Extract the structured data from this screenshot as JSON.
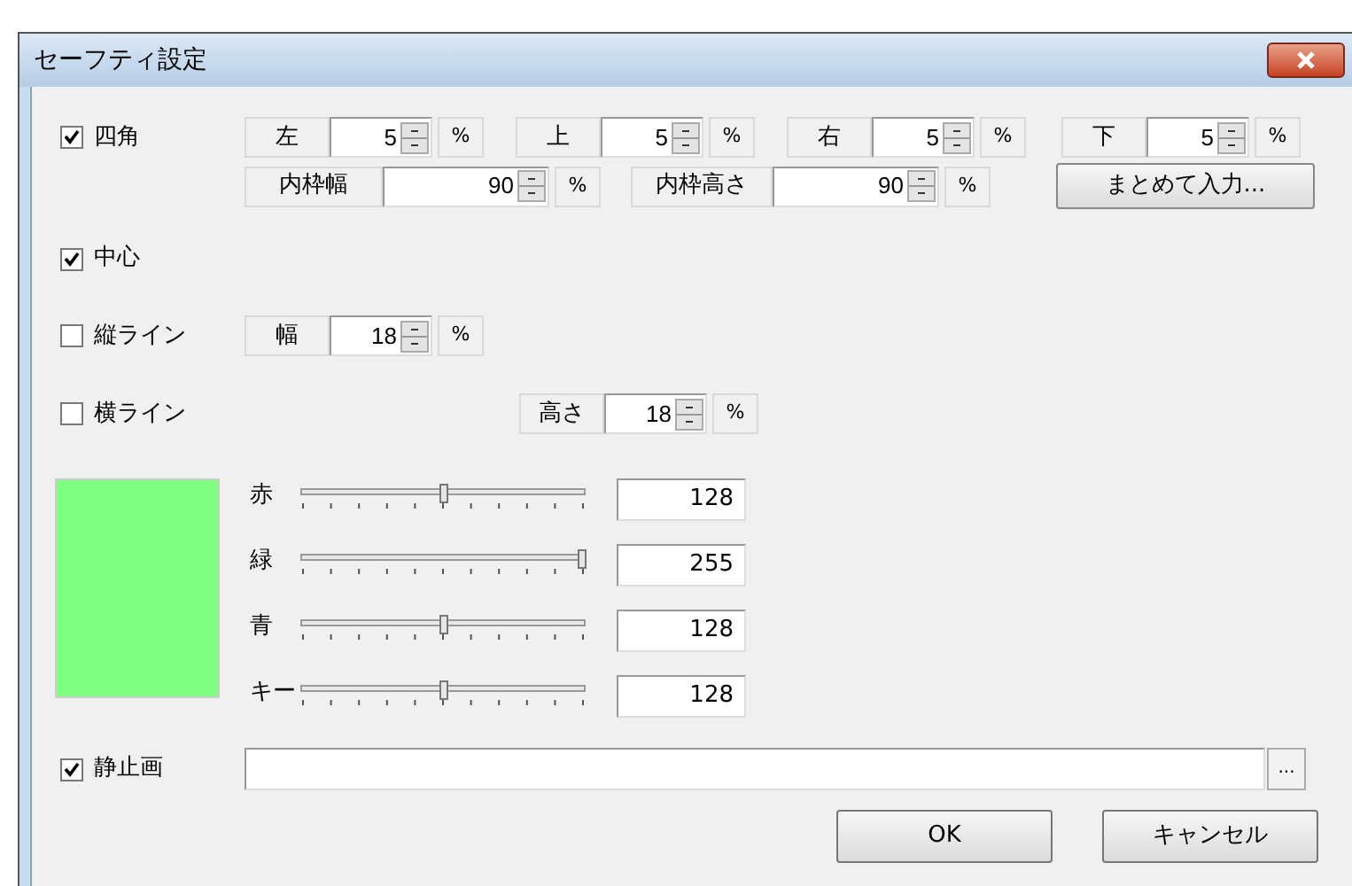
{
  "window": {
    "title": "セーフティ設定"
  },
  "rect": {
    "label": "四角",
    "checked": true,
    "margins": [
      {
        "label": "左",
        "value": "5",
        "unit": "%"
      },
      {
        "label": "上",
        "value": "5",
        "unit": "%"
      },
      {
        "label": "右",
        "value": "5",
        "unit": "%"
      },
      {
        "label": "下",
        "value": "5",
        "unit": "%"
      }
    ],
    "inner": [
      {
        "label": "内枠幅",
        "value": "90",
        "unit": "%"
      },
      {
        "label": "内枠高さ",
        "value": "90",
        "unit": "%"
      }
    ],
    "bulk_button": "まとめて入力..."
  },
  "center": {
    "label": "中心",
    "checked": true
  },
  "vline": {
    "label": "縦ライン",
    "checked": false,
    "width": {
      "label": "幅",
      "value": "18",
      "unit": "%"
    }
  },
  "hline": {
    "label": "横ライン",
    "checked": false,
    "height": {
      "label": "高さ",
      "value": "18",
      "unit": "%"
    }
  },
  "color": {
    "preview": {
      "color": "#80ff80"
    },
    "channels": [
      {
        "label": "赤",
        "level": 0.502,
        "value": "128"
      },
      {
        "label": "緑",
        "level": 1,
        "value": "255"
      },
      {
        "label": "青",
        "level": 0.502,
        "value": "128"
      },
      {
        "label": "キー",
        "level": 0.502,
        "value": "128"
      }
    ]
  },
  "still_image": {
    "label": "静止画",
    "checked": true,
    "browse": "..."
  },
  "buttons": [
    "OK",
    "キャンセル"
  ]
}
